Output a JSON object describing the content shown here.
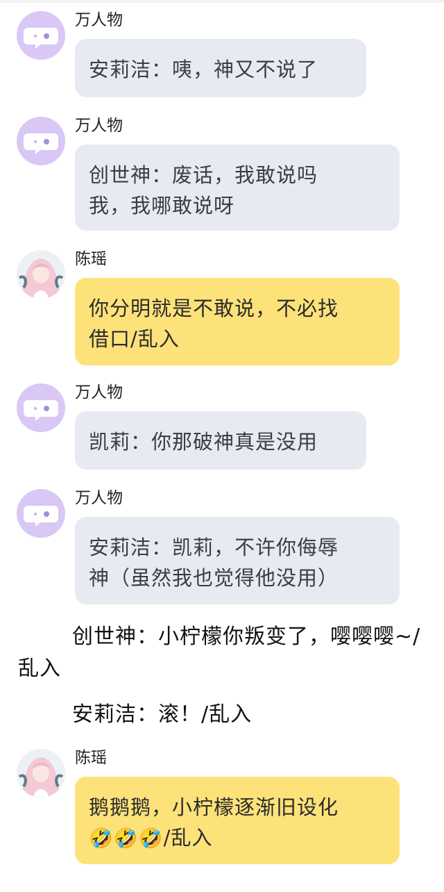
{
  "messages": [
    {
      "sender": "万人物",
      "text": "安莉洁：咦，神又不说了"
    },
    {
      "sender": "万人物",
      "line1": "创世神：废话，我敢说吗",
      "line2": "我，我哪敢说呀"
    },
    {
      "sender": "陈瑶",
      "line1": "你分明就是不敢说，不必找",
      "line2": "借口/乱入"
    },
    {
      "sender": "万人物",
      "text": "凯莉：你那破神真是没用"
    },
    {
      "sender": "万人物",
      "line1": "安莉洁：凯莉，不许你侮辱",
      "line2": "神（虽然我也觉得他没用）"
    },
    {
      "sender": "陈瑶",
      "line1": "鹅鹅鹅，小柠檬逐渐旧设化",
      "line2_emoji": "🤣🤣🤣",
      "line2_text": "/乱入"
    }
  ],
  "narration": [
    "创世神：小柠檬你叛变了，嘤嘤嘤~/乱入",
    "安莉洁：滚！/乱入"
  ],
  "colors": {
    "bot_bubble": "#e7ebf1",
    "user_bubble": "#fde27a",
    "bot_avatar": "#d9c7f5"
  }
}
